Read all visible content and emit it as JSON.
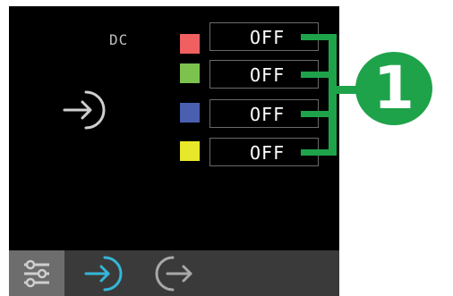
{
  "screen": {
    "dc_label": "DC",
    "channels": [
      {
        "color": "#f06060",
        "value": "OFF"
      },
      {
        "color": "#7cc24e",
        "value": "OFF"
      },
      {
        "color": "#4a5fb0",
        "value": "OFF"
      },
      {
        "color": "#e8e82a",
        "value": "OFF"
      }
    ]
  },
  "annotation": {
    "badge_label": "1",
    "color": "#1fa34a"
  },
  "tabs": [
    {
      "icon": "sliders-icon"
    },
    {
      "icon": "input-arrow-icon",
      "active_color": "#35b6d8"
    },
    {
      "icon": "output-arrow-icon"
    }
  ]
}
